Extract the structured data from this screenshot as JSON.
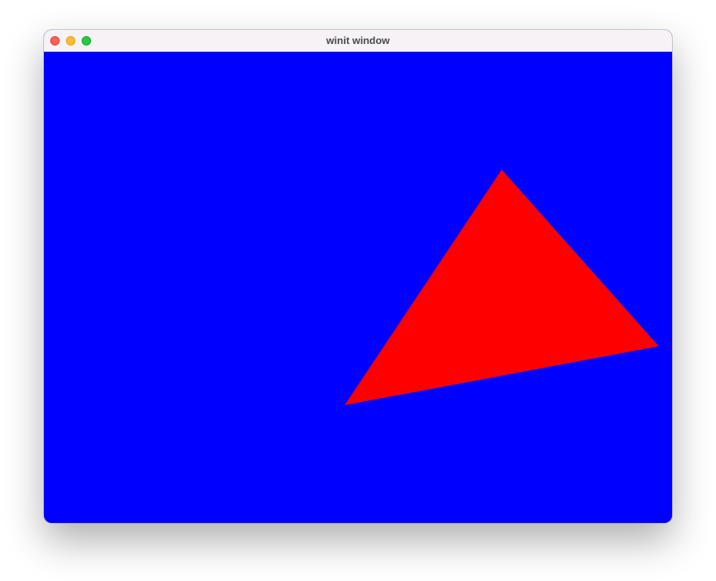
{
  "window": {
    "title": "winit window"
  },
  "colors": {
    "background": "#0000ff",
    "triangle": "#ff0000",
    "titlebar": "#f6f2f5",
    "close": "#ff5f57",
    "minimize": "#febc2e",
    "zoom": "#28c840"
  },
  "canvas": {
    "shape": "triangle"
  }
}
